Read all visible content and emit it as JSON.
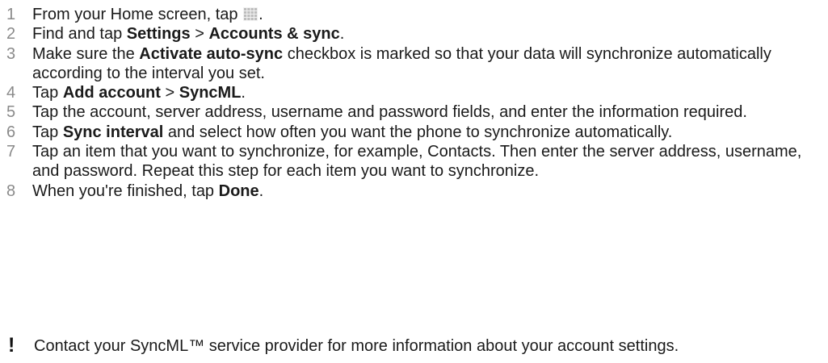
{
  "steps": [
    {
      "number": "1",
      "parts": [
        {
          "t": "From your Home screen, tap ",
          "b": false
        },
        {
          "icon": "app-grid-icon"
        },
        {
          "t": ".",
          "b": false
        }
      ]
    },
    {
      "number": "2",
      "parts": [
        {
          "t": "Find and tap ",
          "b": false
        },
        {
          "t": "Settings",
          "b": true
        },
        {
          "t": " > ",
          "b": false
        },
        {
          "t": "Accounts & sync",
          "b": true
        },
        {
          "t": ".",
          "b": false
        }
      ]
    },
    {
      "number": "3",
      "parts": [
        {
          "t": "Make sure the ",
          "b": false
        },
        {
          "t": "Activate auto-sync",
          "b": true
        },
        {
          "t": " checkbox is marked so that your data will synchronize automatically according to the interval you set.",
          "b": false
        }
      ]
    },
    {
      "number": "4",
      "parts": [
        {
          "t": "Tap ",
          "b": false
        },
        {
          "t": "Add account",
          "b": true
        },
        {
          "t": " > ",
          "b": false
        },
        {
          "t": "SyncML",
          "b": true
        },
        {
          "t": ".",
          "b": false
        }
      ]
    },
    {
      "number": "5",
      "parts": [
        {
          "t": "Tap the account, server address, username and password fields, and enter the information required.",
          "b": false
        }
      ]
    },
    {
      "number": "6",
      "parts": [
        {
          "t": "Tap ",
          "b": false
        },
        {
          "t": "Sync interval",
          "b": true
        },
        {
          "t": " and select how often you want the phone to synchronize automatically.",
          "b": false
        }
      ]
    },
    {
      "number": "7",
      "parts": [
        {
          "t": "Tap an item that you want to synchronize, for example, Contacts. Then enter the server address, username, and password. Repeat this step for each item you want to synchronize.",
          "b": false
        }
      ]
    },
    {
      "number": "8",
      "parts": [
        {
          "t": "When you're finished, tap ",
          "b": false
        },
        {
          "t": "Done",
          "b": true
        },
        {
          "t": ".",
          "b": false
        }
      ]
    }
  ],
  "note": {
    "icon": "!",
    "text": "Contact your SyncML™ service provider for more information about your account settings."
  },
  "colors": {
    "heading_blue": "#1a8fd8",
    "step_number": "#8a8a8a",
    "body_text": "#1a1a1a"
  }
}
